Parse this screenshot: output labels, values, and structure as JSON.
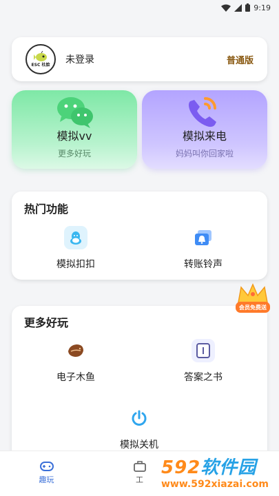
{
  "status_bar": {
    "time": "9:19"
  },
  "user_card": {
    "logo_text": "ESC 杜脸",
    "name": "未登录",
    "version": "普通版"
  },
  "big_buttons": [
    {
      "title": "模拟vv",
      "subtitle": "更多好玩",
      "icon": "wechat-icon",
      "color": "#7ee8a6"
    },
    {
      "title": "模拟来电",
      "subtitle": "妈妈叫你回家啦",
      "icon": "phone-call-icon",
      "color": "#b3a4ff"
    }
  ],
  "hot_section": {
    "title": "热门功能",
    "items": [
      {
        "label": "模拟扣扣",
        "icon": "qq-penguin-icon"
      },
      {
        "label": "转账铃声",
        "icon": "bell-card-icon"
      }
    ]
  },
  "vip_badge": {
    "text": "会员免费送",
    "icon": "crown-icon"
  },
  "more_section": {
    "title": "更多好玩",
    "items": [
      {
        "label": "电子木鱼",
        "icon": "wooden-fish-icon"
      },
      {
        "label": "答案之书",
        "icon": "book-icon"
      },
      {
        "label": "模拟关机",
        "icon": "power-icon"
      }
    ]
  },
  "tabs": [
    {
      "label": "趣玩",
      "icon": "gamepad-icon",
      "active": true
    },
    {
      "label": "工",
      "icon": "toolbox-icon",
      "active": false
    }
  ],
  "watermark": {
    "brand_num": "592",
    "brand_cn": "软件园",
    "url": "www.592xiazai.com"
  },
  "colors": {
    "accent": "#3a6fd8",
    "version_gold": "#8a5a13"
  }
}
